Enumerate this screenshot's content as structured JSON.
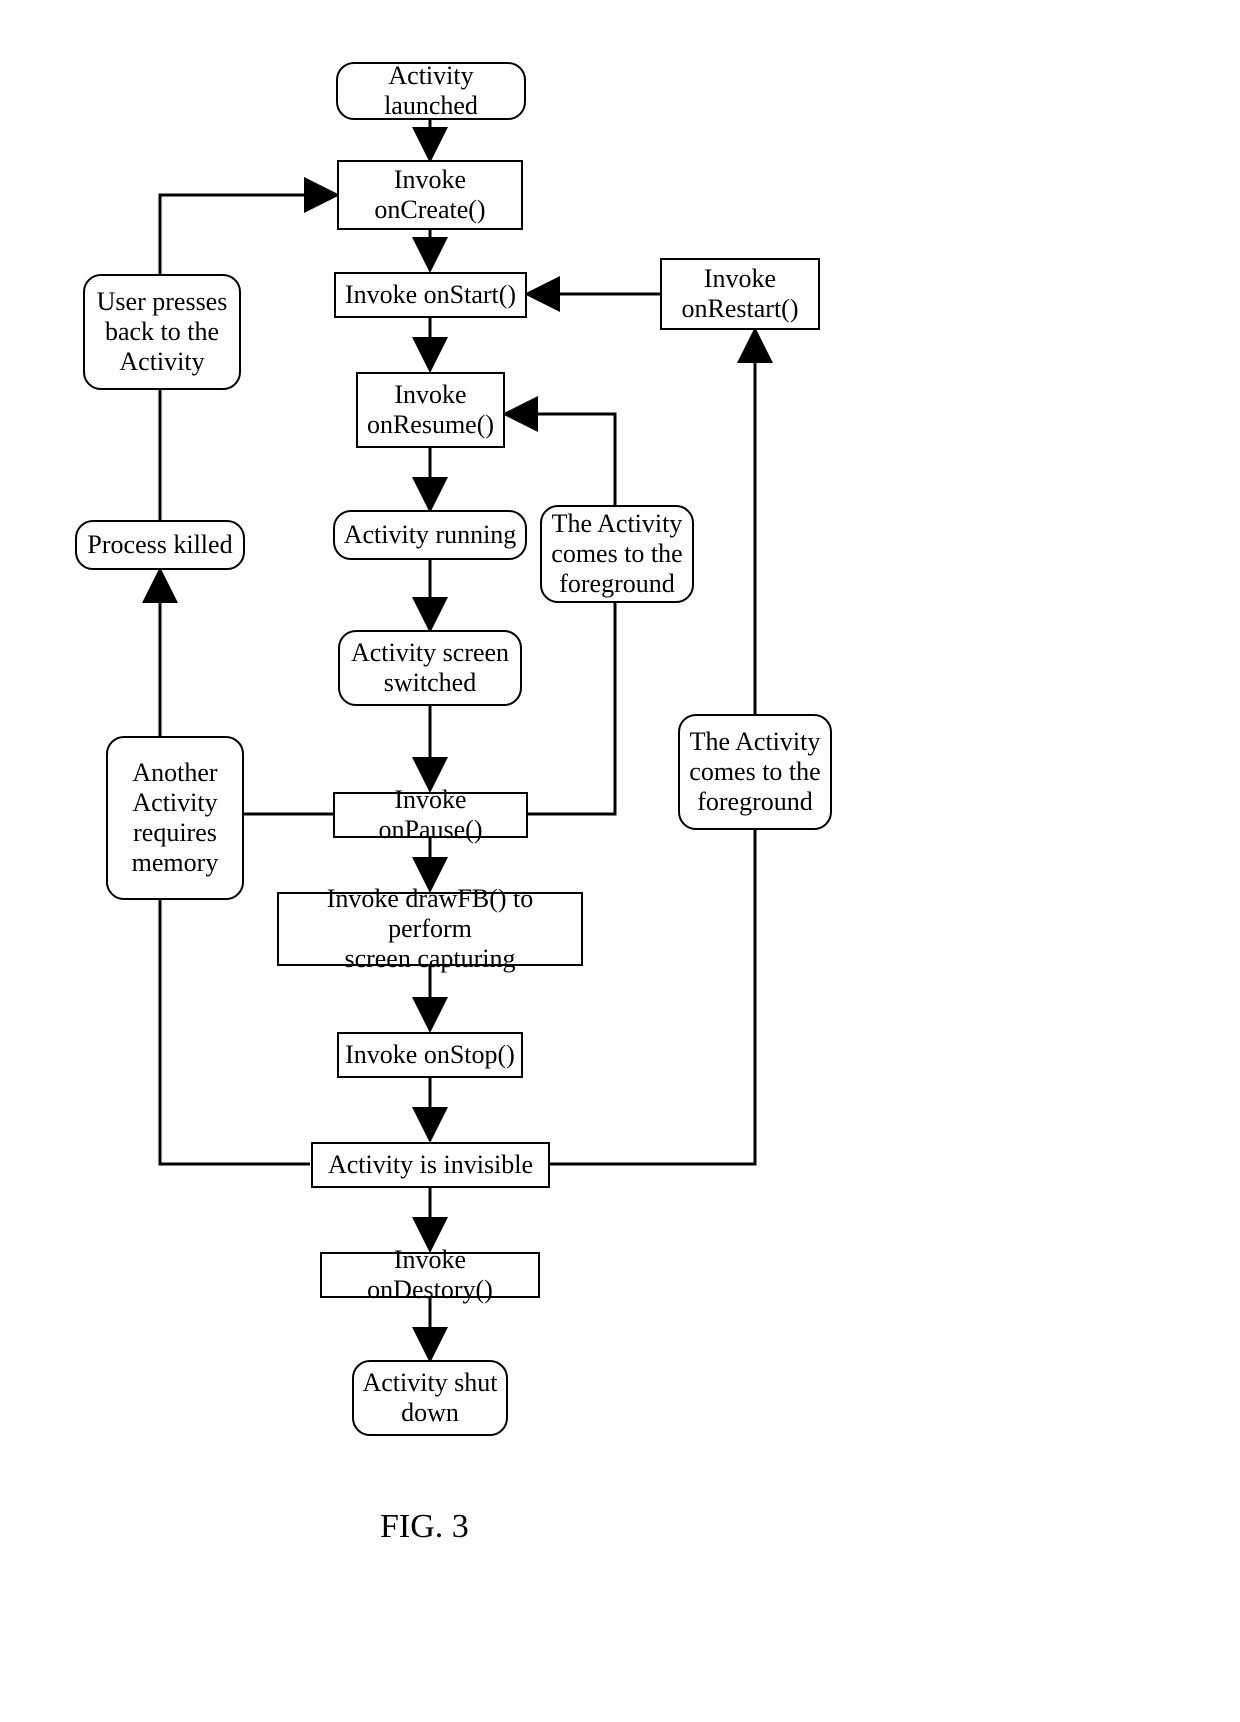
{
  "figure_label": "FIG. 3",
  "nodes": {
    "launched": "Activity launched",
    "oncreate_l1": "Invoke",
    "oncreate_l2": "onCreate()",
    "onstart": "Invoke onStart()",
    "onresume_l1": "Invoke",
    "onresume_l2": "onResume()",
    "running": "Activity running",
    "switched_l1": "Activity screen",
    "switched_l2": "switched",
    "onpause": "Invoke onPause()",
    "drawfb_l1": "Invoke drawFB() to perform",
    "drawfb_l2": "screen capturing",
    "onstop": "Invoke onStop()",
    "invisible": "Activity is invisible",
    "ondestroy": "Invoke onDestory()",
    "shutdown_l1": "Activity shut",
    "shutdown_l2": "down",
    "onrestart_l1": "Invoke",
    "onrestart_l2": "onRestart()",
    "fg1_l1": "The Activity",
    "fg1_l2": "comes to the",
    "fg1_l3": "foreground",
    "fg2_l1": "The Activity",
    "fg2_l2": "comes to the",
    "fg2_l3": "foreground",
    "userback_l1": "User presses",
    "userback_l2": "back to the",
    "userback_l3": "Activity",
    "killed": "Process killed",
    "anothermem_l1": "Another",
    "anothermem_l2": "Activity",
    "anothermem_l3": "requires",
    "anothermem_l4": "memory"
  }
}
